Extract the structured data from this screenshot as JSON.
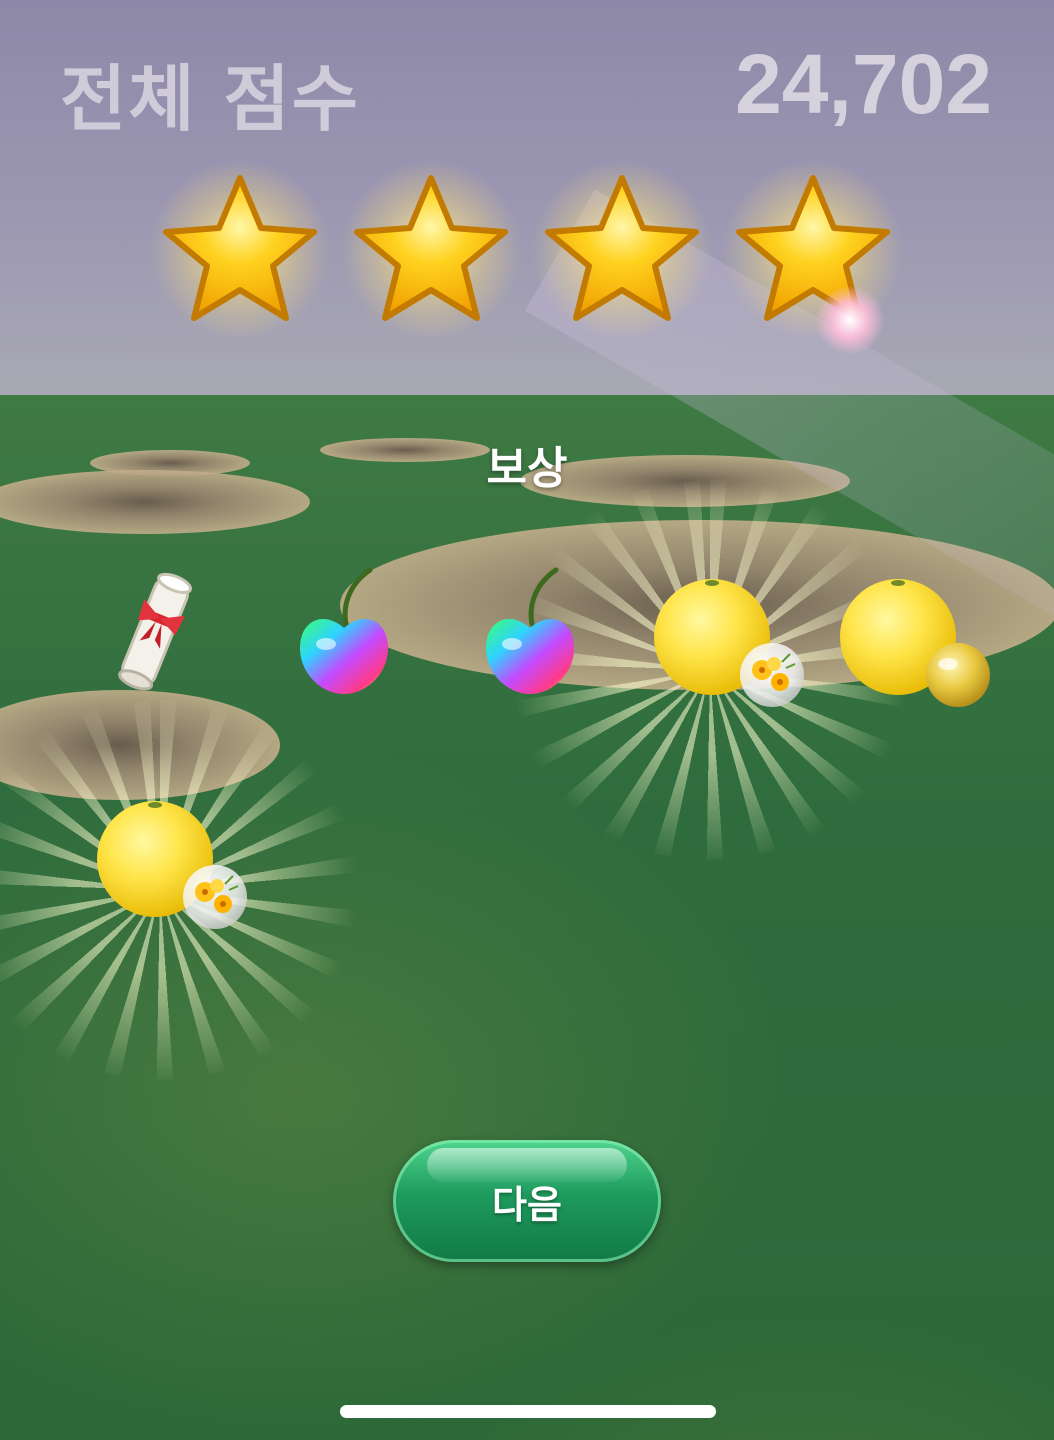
{
  "header": {
    "total_score_label": "전체 점수",
    "total_score_value": "24,702"
  },
  "rating": {
    "stars_earned": 4,
    "icon": "star-icon"
  },
  "rewards": {
    "title": "보상",
    "items": [
      {
        "icon": "scroll-icon"
      },
      {
        "icon": "rainbow-cherry-icon"
      },
      {
        "icon": "rainbow-cherry-icon"
      },
      {
        "icon": "golden-fruit-icon",
        "badge_icon": "flower-bubble-icon"
      },
      {
        "icon": "golden-fruit-icon",
        "badge_icon": "golden-bubble-icon"
      },
      {
        "icon": "golden-fruit-icon",
        "badge_icon": "flower-bubble-icon"
      }
    ]
  },
  "actions": {
    "next_label": "다음"
  },
  "colors": {
    "button_green": "#1e9a5d",
    "star_gold": "#ffc61a",
    "lawn_green": "#2f6c3d"
  }
}
